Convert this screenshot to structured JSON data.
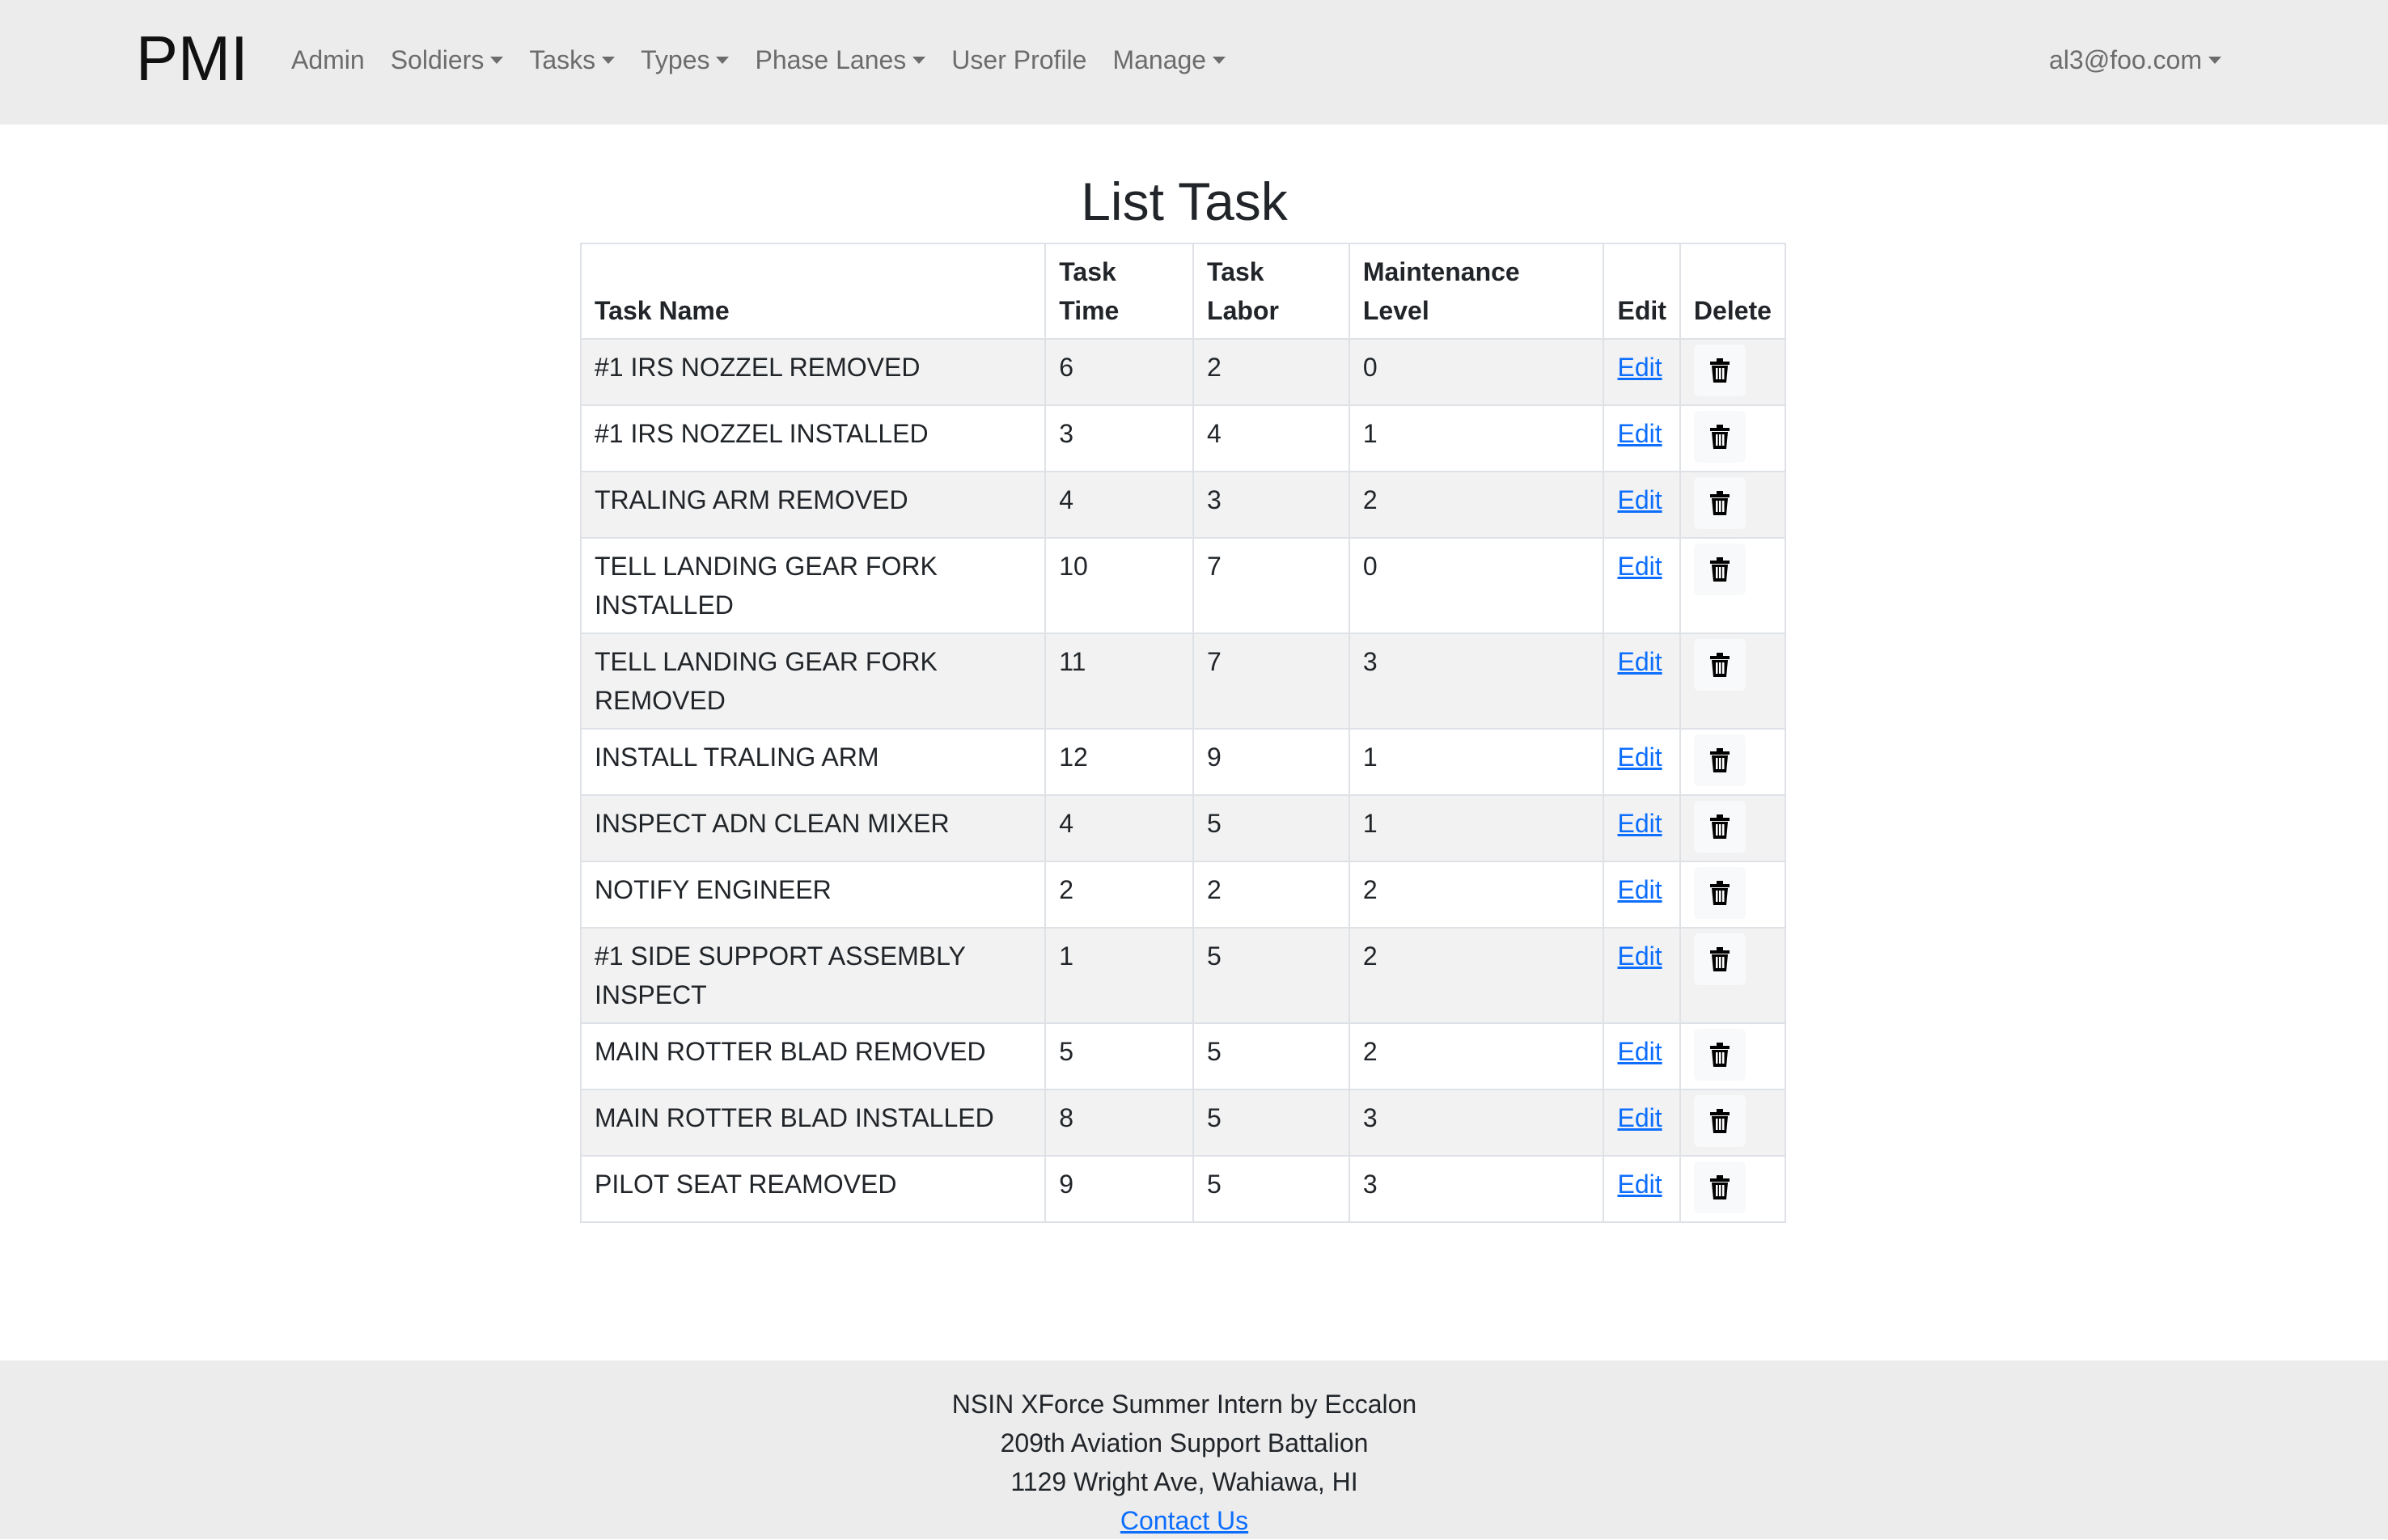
{
  "nav": {
    "brand": "PMI",
    "items": [
      {
        "label": "Admin",
        "dropdown": false
      },
      {
        "label": "Soldiers",
        "dropdown": true
      },
      {
        "label": "Tasks",
        "dropdown": true
      },
      {
        "label": "Types",
        "dropdown": true
      },
      {
        "label": "Phase Lanes",
        "dropdown": true
      },
      {
        "label": "User Profile",
        "dropdown": false
      },
      {
        "label": "Manage",
        "dropdown": true
      }
    ],
    "user": "al3@foo.com"
  },
  "page": {
    "title": "List Task"
  },
  "table": {
    "headers": {
      "task_name": "Task Name",
      "task_time_1": "Task",
      "task_time_2": "Time",
      "task_labor_1": "Task",
      "task_labor_2": "Labor",
      "maint_level_1": "Maintenance",
      "maint_level_2": "Level",
      "edit": "Edit",
      "delete": "Delete"
    },
    "edit_label": "Edit",
    "delete_icon": "trash-icon",
    "rows": [
      {
        "name": "#1 IRS NOZZEL REMOVED",
        "time": "6",
        "labor": "2",
        "level": "0"
      },
      {
        "name": "#1 IRS NOZZEL INSTALLED",
        "time": "3",
        "labor": "4",
        "level": "1"
      },
      {
        "name": "TRALING ARM REMOVED",
        "time": "4",
        "labor": "3",
        "level": "2"
      },
      {
        "name": "TELL LANDING GEAR FORK INSTALLED",
        "time": "10",
        "labor": "7",
        "level": "0"
      },
      {
        "name": "TELL LANDING GEAR FORK REMOVED",
        "time": "11",
        "labor": "7",
        "level": "3"
      },
      {
        "name": "INSTALL TRALING ARM",
        "time": "12",
        "labor": "9",
        "level": "1"
      },
      {
        "name": "INSPECT ADN CLEAN MIXER",
        "time": "4",
        "labor": "5",
        "level": "1"
      },
      {
        "name": "NOTIFY ENGINEER",
        "time": "2",
        "labor": "2",
        "level": "2"
      },
      {
        "name": "#1 SIDE SUPPORT ASSEMBLY INSPECT",
        "time": "1",
        "labor": "5",
        "level": "2"
      },
      {
        "name": "MAIN ROTTER BLAD REMOVED",
        "time": "5",
        "labor": "5",
        "level": "2"
      },
      {
        "name": "MAIN ROTTER BLAD INSTALLED",
        "time": "8",
        "labor": "5",
        "level": "3"
      },
      {
        "name": "PILOT SEAT REAMOVED",
        "time": "9",
        "labor": "5",
        "level": "3"
      }
    ]
  },
  "footer": {
    "line1": "NSIN XForce Summer Intern by Eccalon",
    "line2": "209th Aviation Support Battalion",
    "line3": "1129 Wright Ave, Wahiawa, HI",
    "contact": "Contact Us"
  }
}
